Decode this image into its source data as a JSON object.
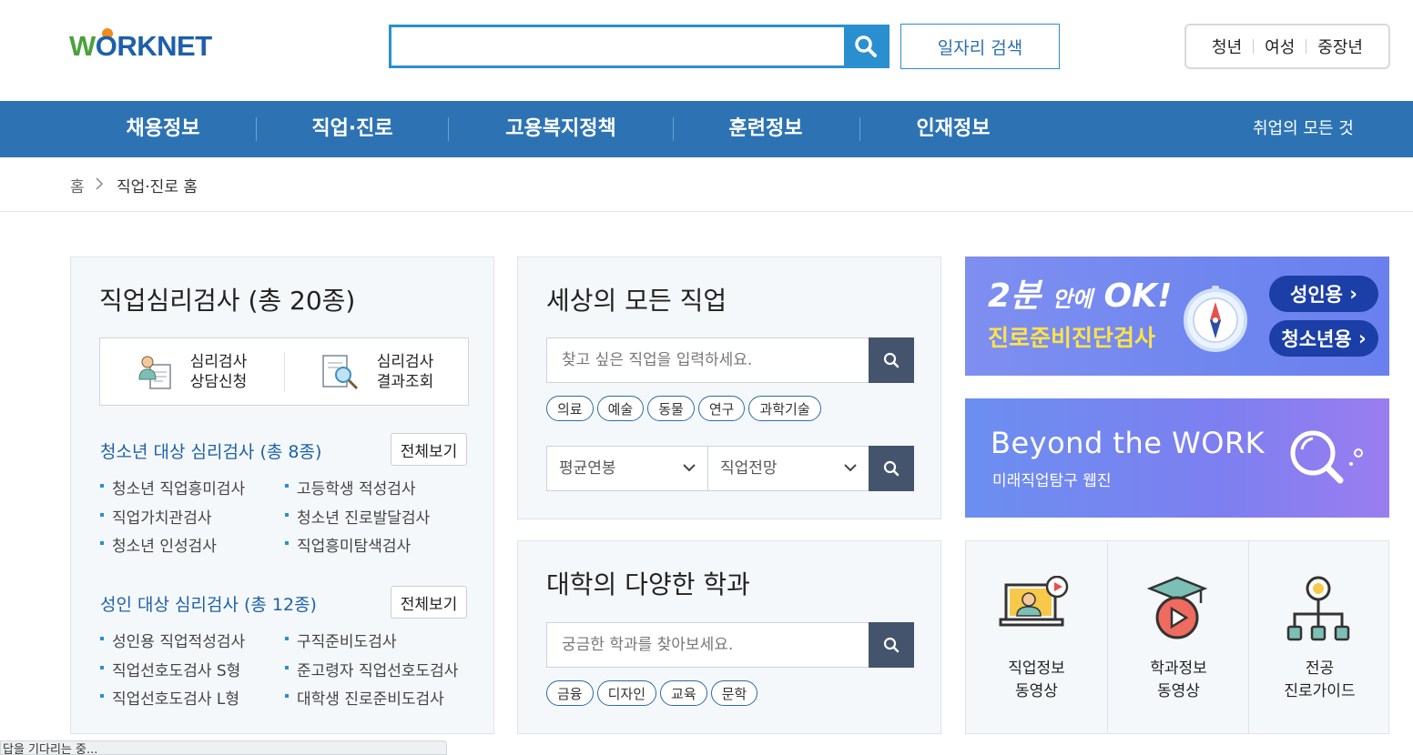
{
  "header": {
    "logo_text": "WORKNET",
    "search_placeholder": "",
    "job_search_label": "일자리 검색",
    "targets": [
      "청년",
      "여성",
      "중장년"
    ]
  },
  "gnb": {
    "menus": [
      "채용정보",
      "직업·진로",
      "고용복지정책",
      "훈련정보",
      "인재정보"
    ],
    "all_label": "취업의 모든 것"
  },
  "breadcrumb": {
    "home": "홈",
    "current": "직업·진로 홈"
  },
  "psy_tests": {
    "title": "직업심리검사 (총 20종)",
    "apply_label_1": "심리검사",
    "apply_label_2": "상담신청",
    "result_label_1": "심리검사",
    "result_label_2": "결과조회",
    "youth": {
      "title": "청소년 대상 심리검사 (총 8종)",
      "view_all": "전체보기",
      "items": [
        "청소년 직업흥미검사",
        "고등학생 적성검사",
        "직업가치관검사",
        "청소년 진로발달검사",
        "청소년 인성검사",
        "직업흥미탐색검사"
      ]
    },
    "adult": {
      "title": "성인 대상 심리검사 (총 12종)",
      "view_all": "전체보기",
      "items": [
        "성인용 직업적성검사",
        "구직준비도검사",
        "직업선호도검사 S형",
        "준고령자 직업선호도검사",
        "직업선호도검사 L형",
        "대학생 진로준비도검사"
      ]
    }
  },
  "jobs": {
    "title": "세상의 모든 직업",
    "placeholder": "찾고 싶은 직업을 입력하세요.",
    "tags": [
      "의료",
      "예술",
      "동물",
      "연구",
      "과학기술"
    ],
    "select_salary": "평균연봉",
    "select_outlook": "직업전망"
  },
  "univ": {
    "title": "대학의 다양한 학과",
    "placeholder": "궁금한 학과를 찾아보세요.",
    "tags": [
      "금융",
      "디자인",
      "교육",
      "문학"
    ]
  },
  "banner1": {
    "headline_big": "2분",
    "headline_mid": "안에",
    "headline_ok": "OK!",
    "subtitle": "진로준비진단검사",
    "btn_adult": "성인용",
    "btn_youth": "청소년용"
  },
  "banner2": {
    "title": "Beyond the WORK",
    "subtitle": "미래직업탐구 웹진"
  },
  "videos": [
    {
      "line1": "직업정보",
      "line2": "동영상"
    },
    {
      "line1": "학과정보",
      "line2": "동영상"
    },
    {
      "line1": "전공",
      "line2": "진로가이드"
    }
  ],
  "status": "답을 기다리는 중..."
}
